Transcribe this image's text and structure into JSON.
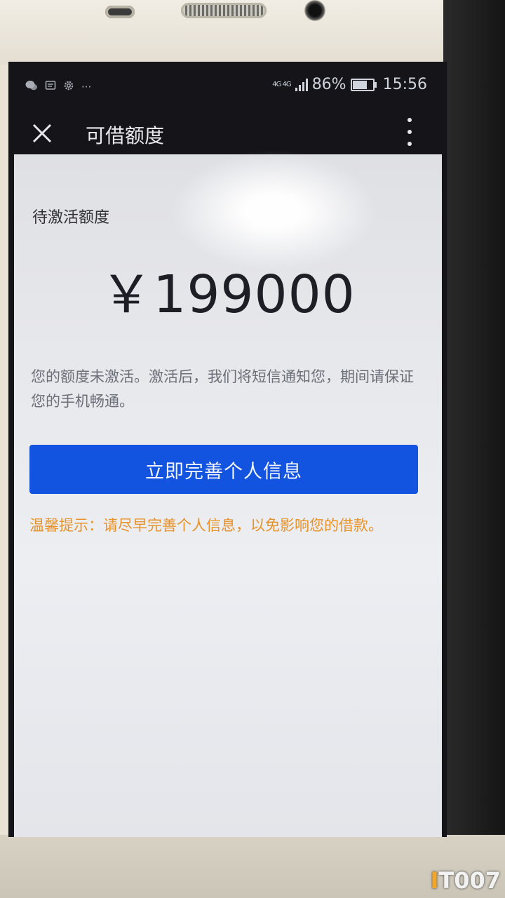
{
  "status_bar": {
    "left_icons": [
      "wechat-icon",
      "message-icon",
      "settings-icon"
    ],
    "more": "···",
    "network": "4G 4G",
    "battery": "86%",
    "battery_level": 0.86,
    "time": "15:56"
  },
  "title_bar": {
    "close_icon": "close-icon",
    "title": "可借额度",
    "more_icon": "more-vertical-icon"
  },
  "content": {
    "section_label": "待激活额度",
    "amount": "￥199000",
    "description": "您的额度未激活。激活后，我们将短信通知您，期间请保证您的手机畅通。",
    "button_label": "立即完善个人信息",
    "tip": "温馨提示：请尽早完善个人信息，以免影响您的借款。"
  },
  "watermark": "IT007",
  "colors": {
    "button": "#1254e0",
    "tip": "#e7932c",
    "title_bar": "#141419"
  }
}
